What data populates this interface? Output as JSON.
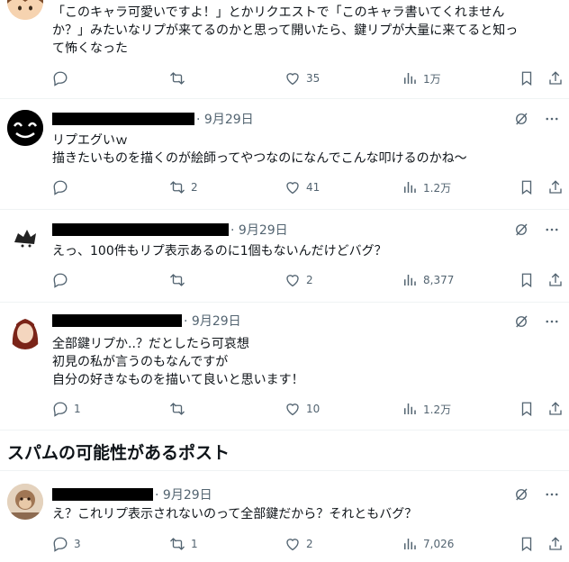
{
  "posts": [
    {
      "text": "「このキャラ可愛いですよ！」とかリクエストで「このキャラ書いてくれません\nか？」みたいなリプが来てるのかと思って開いたら、鍵リプが大量に来てると知っ\nて怖くなった",
      "stats": {
        "reply": "",
        "repost": "",
        "like": "35",
        "views": "1万"
      }
    },
    {
      "date": "9月29日",
      "text": "リプエグいｗ\n描きたいものを描くのが絵師ってやつなのになんでこんな叩けるのかね〜",
      "stats": {
        "reply": "",
        "repost": "2",
        "like": "41",
        "views": "1.2万"
      }
    },
    {
      "date": "9月29日",
      "text": "えっ、100件もリプ表示あるのに1個もないんだけどバグ？",
      "stats": {
        "reply": "",
        "repost": "",
        "like": "2",
        "views": "8,377"
      }
    },
    {
      "date": "9月29日",
      "text": "全部鍵リプか..？だとしたら可哀想\n初見の私が言うのもなんですが\n自分の好きなものを描いて良いと思います！",
      "stats": {
        "reply": "1",
        "repost": "",
        "like": "10",
        "views": "1.2万"
      }
    },
    {
      "date": "9月29日",
      "text": "え？これリプ表示されないのって全部鍵だから？それともバグ？",
      "stats": {
        "reply": "3",
        "repost": "1",
        "like": "2",
        "views": "7,026"
      }
    }
  ],
  "section": {
    "spam_title": "スパムの可能性があるポスト"
  }
}
